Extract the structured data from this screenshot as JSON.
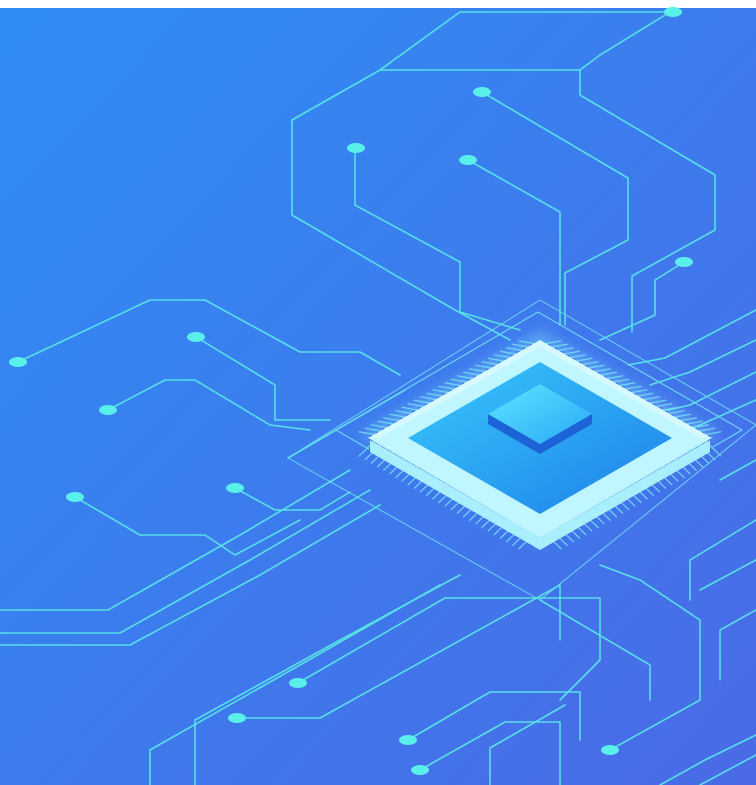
{
  "image": {
    "subject": "isometric-microchip-circuit-board",
    "icon": "microchip-icon",
    "colors": {
      "background_top_left": "#2f8ef5",
      "background_bottom_right": "#4a6ae6",
      "circuit_trace": "#58e6e6",
      "circuit_node": "#5af0ea",
      "chip_frame": "#bff6ff",
      "chip_core": "#2fb6ff",
      "chip_top": "#45d6fb",
      "chip_pins": "#2b58e0",
      "chip_socket": "#6fd9f5"
    }
  }
}
